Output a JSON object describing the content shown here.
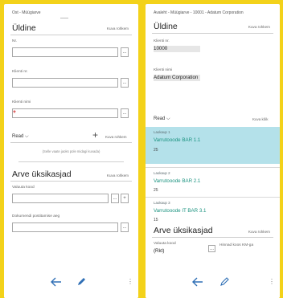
{
  "left": {
    "breadcrumb": "Ost - Müügiarve",
    "general_title": "Üldine",
    "general_link": "Kuva rohkem",
    "field1_label": "Nr.",
    "field2_label": "Klienti nr.",
    "field3_label": "Klienti nimi",
    "required_mark": "*",
    "lookup_glyph": "...",
    "rows_label": "Read ⌵",
    "add_glyph": "+",
    "rows_link": "Kuva rohkem",
    "empty_note": "(Selle vaate jaoks pole midagi kuvada)",
    "invoice_title": "Arve üksikasjad",
    "invoice_link": "Kuva rohkem",
    "field4_label": "Valuuta kood",
    "field5_label": "Dokumendi postitamise aeg",
    "add_glyph2": "+"
  },
  "right": {
    "breadcrumb": "Avaleht - Müügiarve - 10001 - Adatum Corporation",
    "general_title": "Üldine",
    "general_link": "Kuva rohkem",
    "customer_no_label": "Klienti nr.",
    "customer_no_value": "10000",
    "customer_name_label": "Klienti nimi",
    "customer_name_value": "Adatum Corporation",
    "rows_label": "Read ⌵",
    "rows_link": "Kuva kõik",
    "lines": [
      {
        "sub": "Laokaup 1",
        "title": "Varrutooode BAR 1.1",
        "qty": "25"
      },
      {
        "sub": "Laokaup 2",
        "title": "Varrutooode BAR 2.1",
        "qty": "25"
      },
      {
        "sub": "Laokaup 3",
        "title": "Varrutooode IT BAR 3.1",
        "qty": "15"
      }
    ],
    "invoice_title": "Arve üksikasjad",
    "invoice_link": "Kuva rohkem",
    "currency_label": "Valuuta kood",
    "currency_value": "(Rkt)",
    "price_incl_vat_label": "Hinnad koos KM-ga",
    "lookup_glyph": "..."
  },
  "colors": {
    "background": "#f3d21a",
    "highlight": "#b4e1ea",
    "link_teal": "#19927f",
    "required": "#d01f1f",
    "icon_blue": "#2f6fb5"
  },
  "icons": {
    "back": "back-arrow-icon",
    "edit": "pencil-edit-icon",
    "menu": "more-vertical-icon"
  }
}
